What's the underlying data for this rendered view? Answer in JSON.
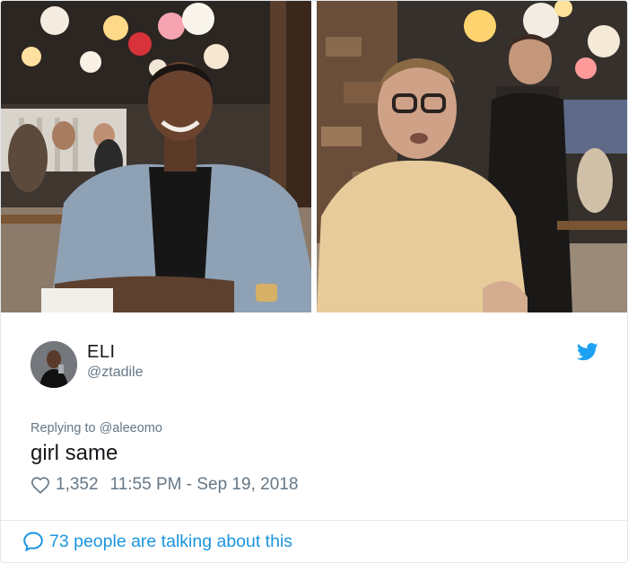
{
  "tweet": {
    "display_name": "ELI",
    "handle": "@ztadile",
    "replying_to": "Replying to @aleeomo",
    "text": "girl same",
    "likes": "1,352",
    "timestamp": "11:55 PM - Sep 19, 2018",
    "talking": "73 people are talking about this"
  },
  "icons": {
    "brand": "twitter-bird-icon",
    "like": "heart-icon",
    "conversation": "speech-bubble-icon"
  },
  "colors": {
    "twitter_blue": "#1da1f2",
    "link_blue": "#1b95e0",
    "secondary_text": "#657786"
  }
}
